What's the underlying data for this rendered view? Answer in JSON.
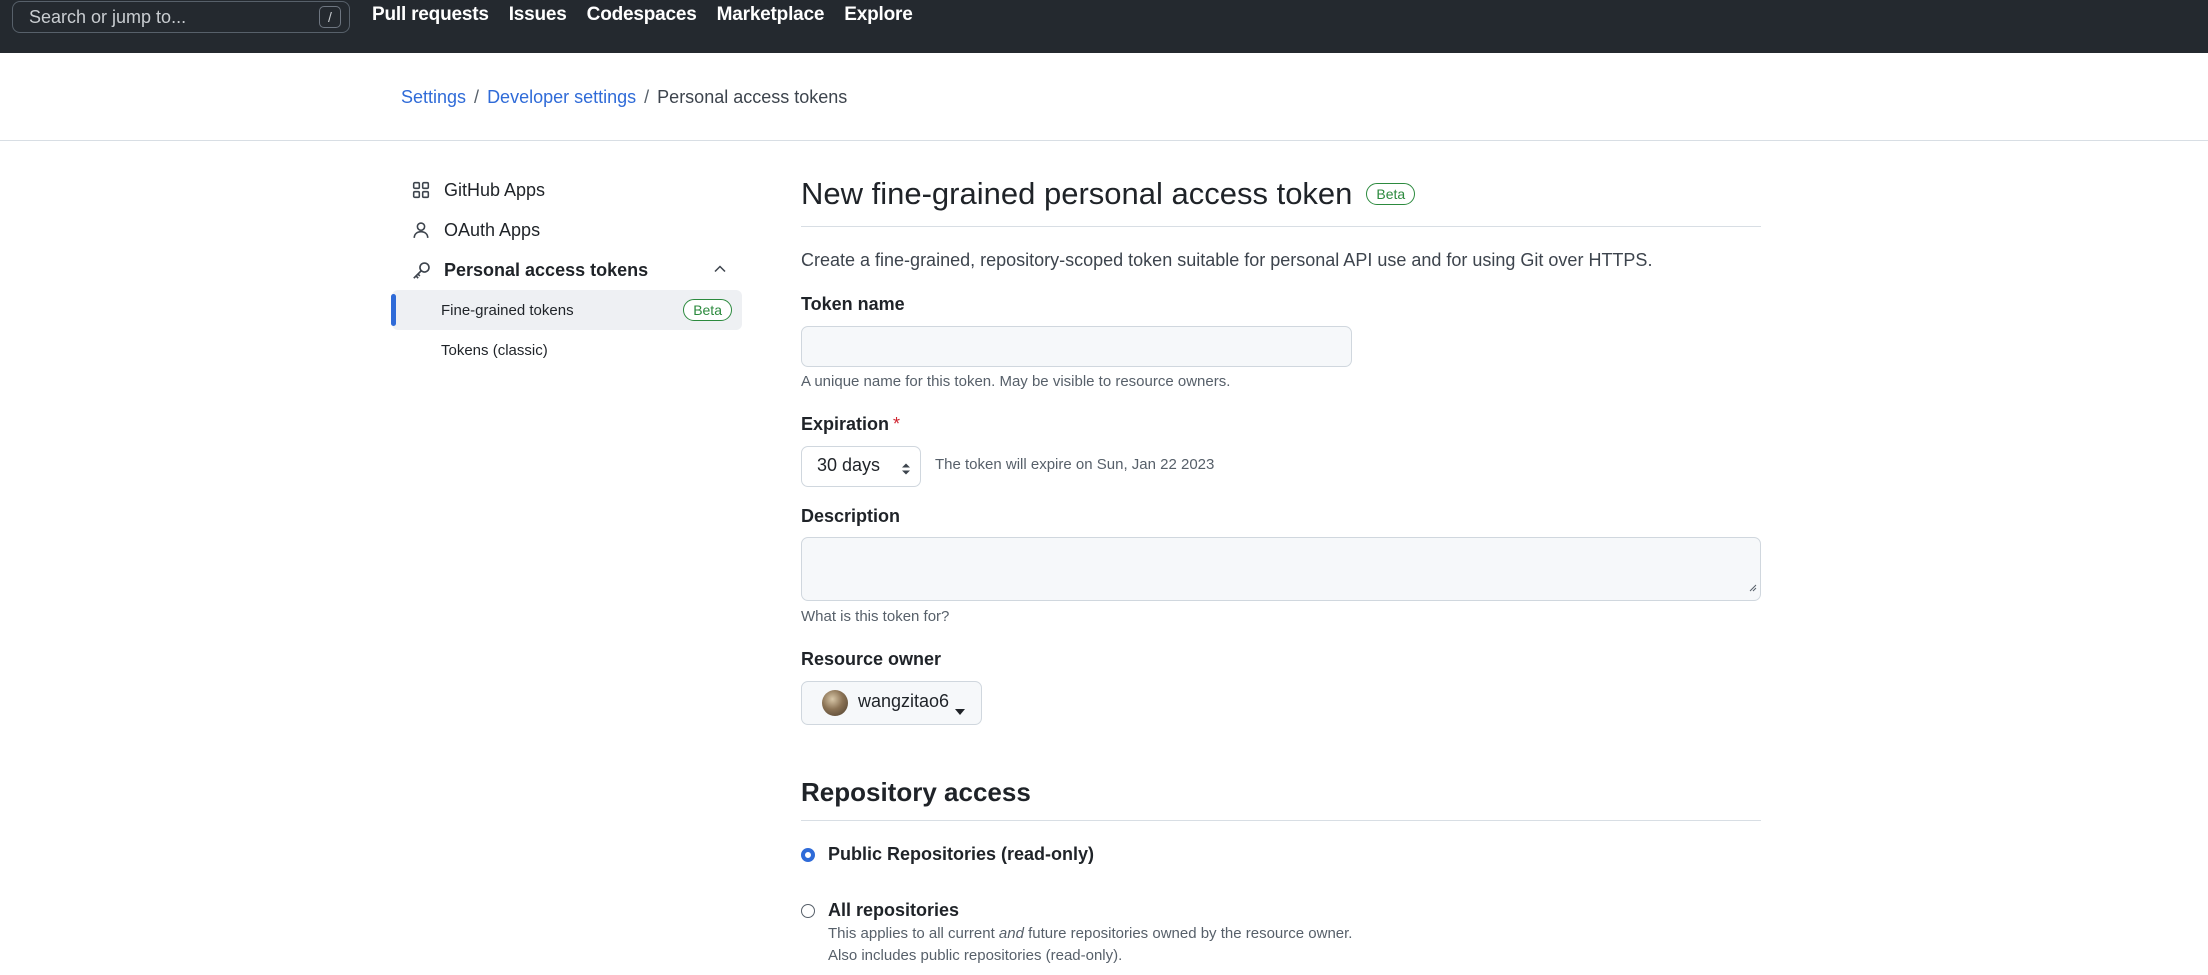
{
  "header": {
    "search_placeholder": "Search or jump to...",
    "search_shortcut": "/",
    "nav": [
      "Pull requests",
      "Issues",
      "Codespaces",
      "Marketplace",
      "Explore"
    ]
  },
  "breadcrumb": {
    "items": [
      "Settings",
      "Developer settings"
    ],
    "separator": "/",
    "current": "Personal access tokens"
  },
  "sidebar": {
    "items": [
      {
        "label": "GitHub Apps",
        "icon": "apps-grid-icon"
      },
      {
        "label": "OAuth Apps",
        "icon": "person-icon"
      },
      {
        "label": "Personal access tokens",
        "icon": "key-icon"
      }
    ],
    "sub_items": [
      {
        "label": "Fine-grained tokens",
        "badge": "Beta"
      },
      {
        "label": "Tokens (classic)"
      }
    ]
  },
  "main": {
    "title": "New fine-grained personal access token",
    "title_badge": "Beta",
    "lead": "Create a fine-grained, repository-scoped token suitable for personal API use and for using Git over HTTPS.",
    "token_name": {
      "label": "Token name",
      "value": "",
      "hint": "A unique name for this token. May be visible to resource owners."
    },
    "expiration": {
      "label": "Expiration",
      "required_mark": "*",
      "selected": "30 days",
      "note": "The token will expire on Sun, Jan 22 2023"
    },
    "description": {
      "label": "Description",
      "value": "",
      "hint": "What is this token for?"
    },
    "resource_owner": {
      "label": "Resource owner",
      "selected": "wangzitao6"
    },
    "repository_access": {
      "title": "Repository access",
      "options": [
        {
          "label": "Public Repositories (read-only)",
          "checked": true
        },
        {
          "label": "All repositories",
          "checked": false,
          "desc_before": "This applies to all current ",
          "desc_em": "and",
          "desc_after": " future repositories owned by the resource owner.",
          "desc_line2": "Also includes public repositories (read-only)."
        }
      ]
    }
  },
  "colors": {
    "header_bg": "#24292f",
    "link": "#2f6bd8",
    "badge_green": "#2c8a3e",
    "required_red": "#cf222e"
  }
}
